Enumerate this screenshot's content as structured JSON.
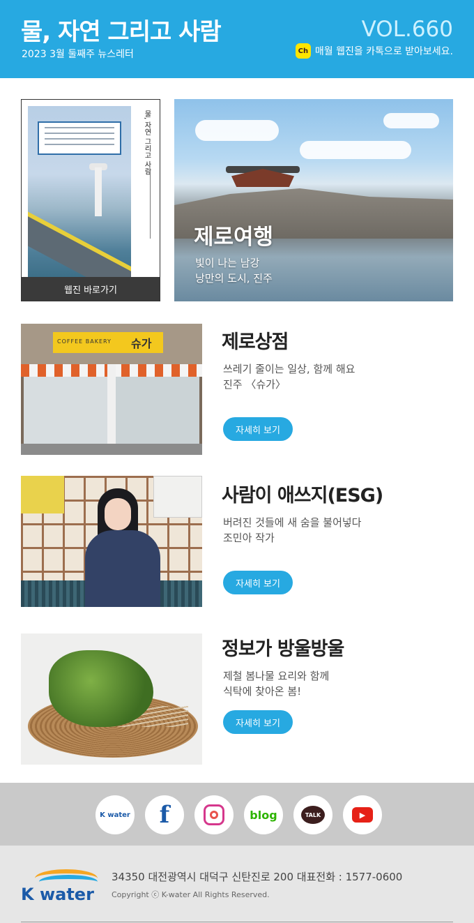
{
  "header": {
    "title": "물, 자연 그리고 사람",
    "subtitle": "2023 3월 둘째주 뉴스레터",
    "volume": "VOL.660",
    "kakao_badge": "Ch",
    "kakao_text": "매월 웹진을 카톡으로 받아보세요."
  },
  "webzine": {
    "spine_text": "물, 자연 그리고 사람",
    "link_label": "웹진 바로가기"
  },
  "hero": {
    "title": "제로여행",
    "line1": "빛이 나는 남강",
    "line2": "낭만의 도시, 진주"
  },
  "articles": [
    {
      "title": "제로상점",
      "line1": "쓰레기 줄이는 일상, 함께 해요",
      "line2": "진주 〈슈가〉",
      "button": "자세히 보기",
      "image_sign_text": "COFFEE BAKERY",
      "image_sign_name": "슈가"
    },
    {
      "title": "사람이 애쓰지(ESG)",
      "line1": "버려진 것들에 새 숨을 불어넣다",
      "line2": "조민아 작가",
      "button": "자세히 보기"
    },
    {
      "title": "정보가 방울방울",
      "line1": "제철 봄나물 요리와 함께",
      "line2": "식탁에 찾아온 봄!",
      "button": "자세히 보기"
    }
  ],
  "social": {
    "kwater_label": "K water",
    "facebook_label": "f",
    "blog_label": "blog",
    "talk_label": "TALK",
    "youtube_label": "▶",
    "icons": [
      "kwater-icon",
      "facebook-icon",
      "instagram-icon",
      "blog-icon",
      "kakaotalk-icon",
      "youtube-icon"
    ]
  },
  "footer": {
    "logo_text": "K water",
    "address": "34350 대전광역시 대덕구 신탄진로 200   대표전화 : 1577-0600",
    "copyright": "Copyright ⓒ K-water All Rights Reserved."
  },
  "colors": {
    "brand_blue": "#27a9e1",
    "kakao_yellow": "#fee500",
    "dark_text": "#222222"
  }
}
